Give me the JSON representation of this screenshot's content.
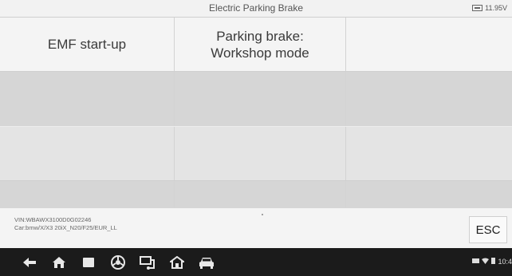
{
  "header": {
    "title": "Electric Parking Brake",
    "voltage": "11.95V"
  },
  "functions": [
    {
      "label": "EMF start-up"
    },
    {
      "label_line1": "Parking brake:",
      "label_line2": "Workshop mode"
    }
  ],
  "footer": {
    "vin": "VIN:WBAWX3100D0G02246",
    "car": "Car:bmw/X/X3 20iX_N20/F25/EUR_LL",
    "esc_label": "ESC"
  },
  "navbar": {
    "icons": [
      "back-icon",
      "home-icon",
      "recent-apps-icon",
      "browser-icon",
      "vci-connection-icon",
      "home-garage-icon",
      "vehicle-icon"
    ],
    "time": "10:4"
  }
}
